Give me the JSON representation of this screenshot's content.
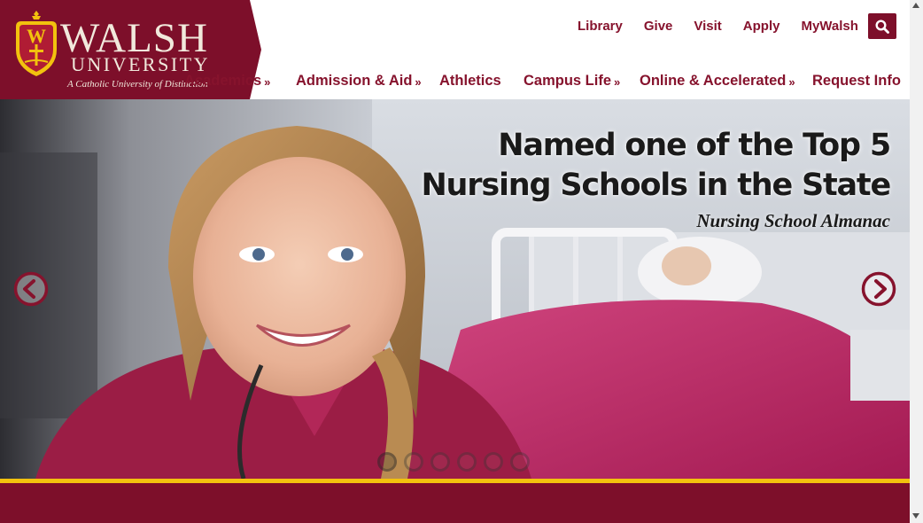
{
  "brand": {
    "word": "WALSH",
    "sub": "UNIVERSITY",
    "tagline": "A Catholic University of Distinction",
    "colors": {
      "maroon": "#7d0f2a",
      "gold": "#f2c20e",
      "cream": "#f1e9dc"
    }
  },
  "utility_nav": {
    "items": [
      {
        "label": "Library"
      },
      {
        "label": "Give"
      },
      {
        "label": "Visit"
      },
      {
        "label": "Apply"
      },
      {
        "label": "MyWalsh"
      }
    ],
    "search_icon": "search-icon"
  },
  "main_nav": {
    "items": [
      {
        "label": "Academics",
        "has_submenu": true
      },
      {
        "label": "Admission & Aid",
        "has_submenu": true
      },
      {
        "label": "Athletics",
        "has_submenu": false
      },
      {
        "label": "Campus Life",
        "has_submenu": true
      },
      {
        "label": "Online & Accelerated",
        "has_submenu": true
      },
      {
        "label": "Request Info",
        "has_submenu": false
      }
    ],
    "submenu_glyph": "»"
  },
  "hero": {
    "headline_line1": "Named one of the Top 5",
    "headline_line2": "Nursing Schools in the State",
    "source": "Nursing School Almanac",
    "prev_icon": "chevron-left-circle-icon",
    "next_icon": "chevron-right-circle-icon",
    "slide_count": 6,
    "active_slide": 1
  }
}
